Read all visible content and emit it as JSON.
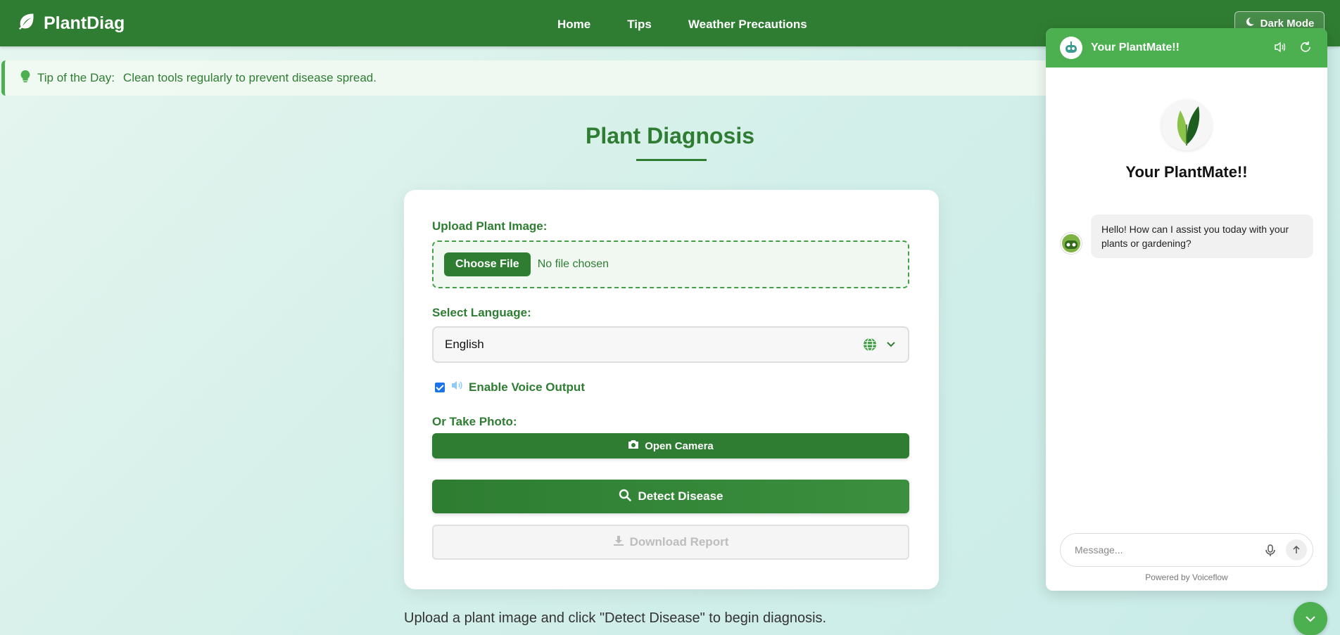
{
  "nav": {
    "brand": "PlantDiag",
    "links": [
      "Home",
      "Tips",
      "Weather Precautions"
    ],
    "dark_mode_label": "Dark Mode"
  },
  "tip": {
    "label": "Tip of the Day:",
    "text": "Clean tools regularly to prevent disease spread."
  },
  "main": {
    "title": "Plant Diagnosis",
    "upload_label": "Upload Plant Image:",
    "choose_file_label": "Choose File",
    "no_file_text": "No file chosen",
    "language_label": "Select Language:",
    "language_value": "English",
    "voice_output_label": "Enable Voice Output",
    "voice_output_checked": true,
    "take_photo_label": "Or Take Photo:",
    "open_camera_label": "Open Camera",
    "detect_label": "Detect Disease",
    "download_label": "Download Report",
    "hint": "Upload a plant image and click \"Detect Disease\" to begin diagnosis."
  },
  "chat": {
    "header_title": "Your PlantMate!!",
    "bot_title": "Your PlantMate!!",
    "message": "Hello! How can I assist you today with your plants or gardening?",
    "input_placeholder": "Message...",
    "powered_by": "Powered by Voiceflow"
  },
  "colors": {
    "primary": "#2e7d32",
    "accent": "#4caf50"
  }
}
